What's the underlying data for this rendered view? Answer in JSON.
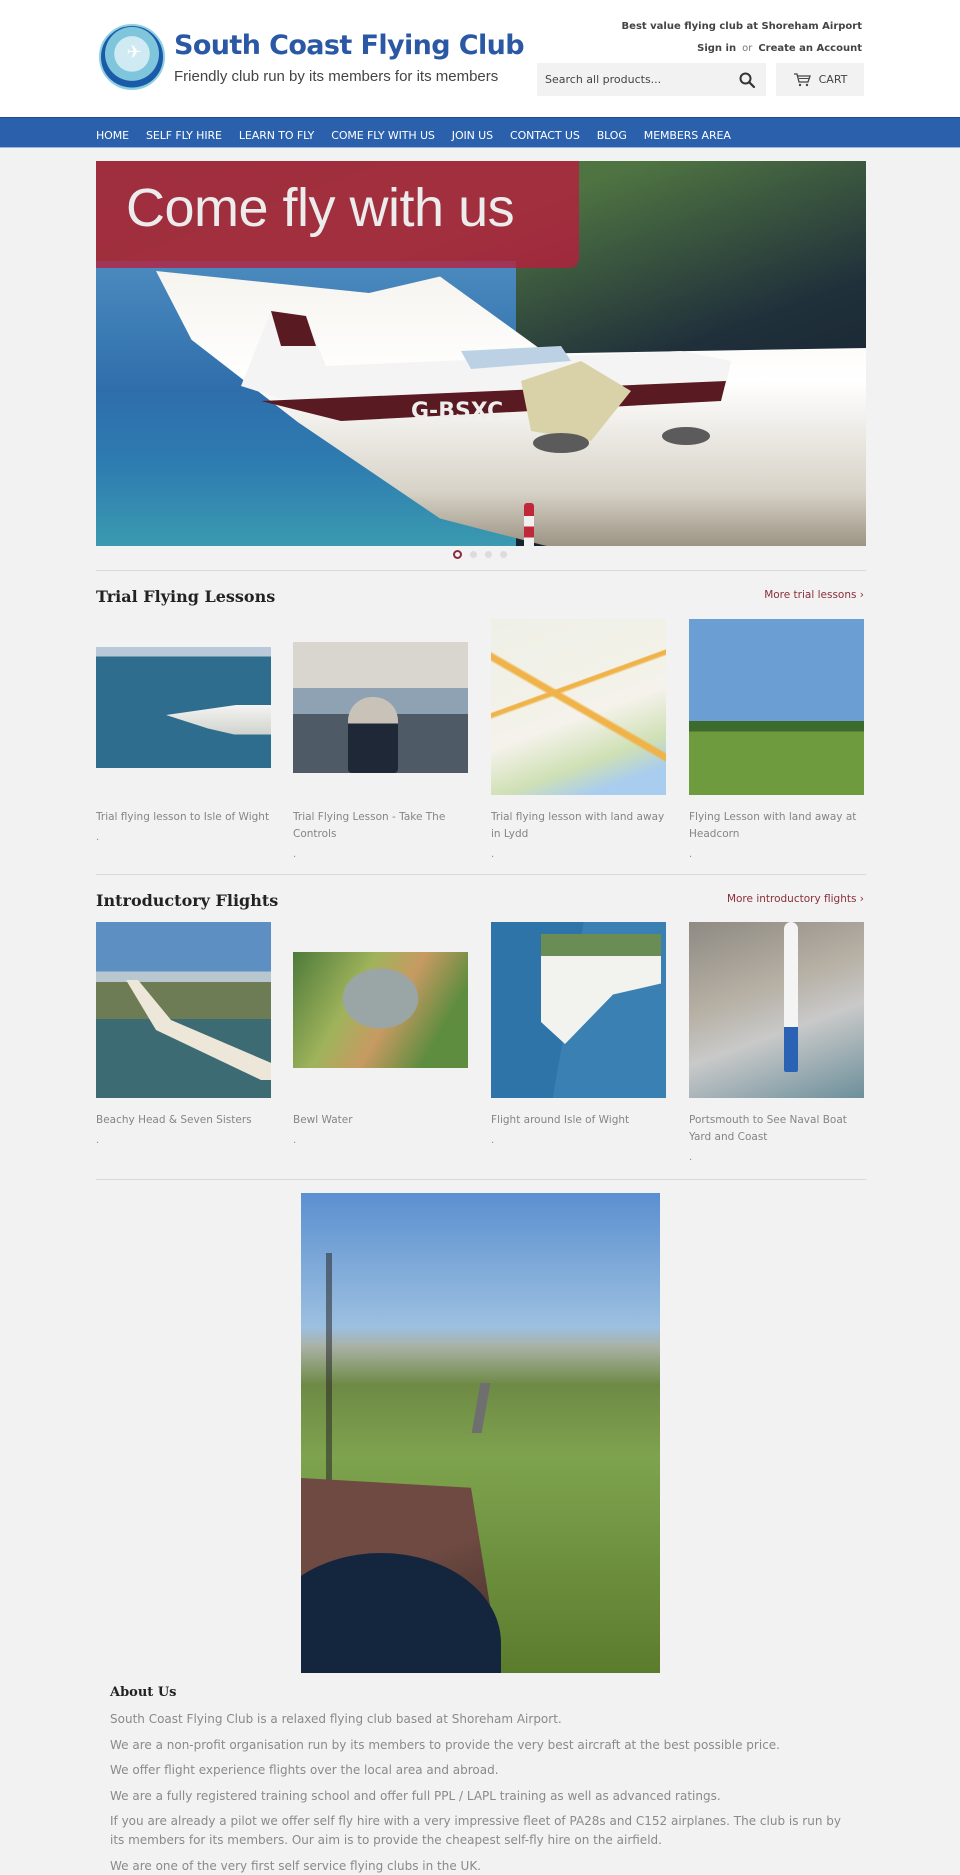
{
  "header": {
    "logo_title": "South Coast Flying Club",
    "logo_tagline": "Friendly club run by its members for its members",
    "tagline": "Best value flying club at Shoreham Airport",
    "sign_in": "Sign in",
    "or": "or",
    "create_account": "Create an Account",
    "search_placeholder": "Search all products...",
    "search_icon": "search-icon",
    "cart_label": "CART",
    "cart_icon": "cart-icon"
  },
  "nav": {
    "items": [
      {
        "label": "HOME"
      },
      {
        "label": "SELF FLY HIRE"
      },
      {
        "label": "LEARN TO FLY"
      },
      {
        "label": "COME FLY WITH US"
      },
      {
        "label": "JOIN US"
      },
      {
        "label": "CONTACT US"
      },
      {
        "label": "BLOG"
      },
      {
        "label": "MEMBERS AREA"
      }
    ]
  },
  "hero": {
    "banner_text": "Come fly with us",
    "aircraft_registration": "G-BSXC",
    "slides_count": 4,
    "active_slide": 1
  },
  "trial": {
    "title": "Trial Flying Lessons",
    "more_link": "More trial lessons ›",
    "products": [
      {
        "title": "Trial flying lesson to Isle of Wight",
        "price": "."
      },
      {
        "title": "Trial Flying Lesson - Take The Controls",
        "price": "."
      },
      {
        "title": "Trial flying lesson with land away in Lydd",
        "price": "."
      },
      {
        "title": "Flying Lesson with land away at Headcorn",
        "price": "."
      }
    ]
  },
  "intro": {
    "title": "Introductory Flights",
    "more_link": "More introductory flights ›",
    "products": [
      {
        "title": "Beachy Head & Seven Sisters",
        "price": "."
      },
      {
        "title": "Bewl Water",
        "price": "."
      },
      {
        "title": "Flight around Isle of Wight",
        "price": "."
      },
      {
        "title": "Portsmouth to See Naval Boat Yard and Coast",
        "price": "."
      }
    ]
  },
  "about": {
    "title": "About Us",
    "paragraphs": [
      "South Coast Flying Club is a relaxed flying club based at Shoreham Airport.",
      "We are a non-profit organisation run by its members to provide the very best aircraft at the best possible price.",
      "We offer flight experience flights over the local area and abroad.",
      "We are a fully registered training school and offer full PPL / LAPL training as well as advanced ratings.",
      "If you are already a pilot we offer self fly hire with a very impressive fleet of PA28s and C152 airplanes. The club is run by its members for its members. Our aim is to provide the cheapest self-fly hire on the airfield.",
      "We are one of the very first self service flying clubs in the UK."
    ]
  },
  "colors": {
    "nav_bg": "#2b60ad",
    "brand_blue": "#2b58a4",
    "link_accent": "#8b2e3a",
    "page_bg": "#f2f2f2"
  }
}
